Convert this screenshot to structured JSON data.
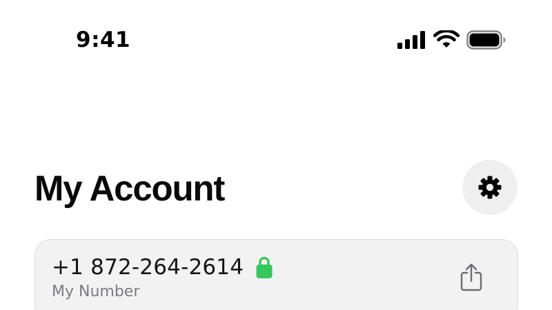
{
  "status_bar": {
    "time": "9:41",
    "icons": [
      "cellular-signal-icon",
      "wifi-icon",
      "battery-icon"
    ]
  },
  "header": {
    "title": "My Account",
    "settings_icon": "gear-icon"
  },
  "account_card": {
    "phone_number": "+1 872-264-2614",
    "caption": "My Number",
    "lock_icon": "lock-icon",
    "share_icon": "share-icon"
  },
  "colors": {
    "background": "#ffffff",
    "card_background": "#f2f2f3",
    "lock_green": "#34c759",
    "caption_gray": "#7c7c80"
  }
}
